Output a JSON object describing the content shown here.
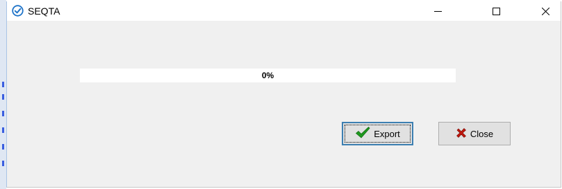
{
  "window": {
    "title": "SEQTA",
    "app_icon": "check-circle-icon",
    "controls": {
      "minimize_icon": "minimize-icon",
      "maximize_icon": "maximize-icon",
      "close_icon": "close-icon"
    }
  },
  "progress": {
    "value": 0,
    "label": "0%",
    "fill_color": "#06b025"
  },
  "buttons": {
    "export": {
      "label": "Export",
      "icon": "checkmark-icon",
      "icon_color": "#1f9a1f"
    },
    "close": {
      "label": "Close",
      "icon": "red-x-icon",
      "icon_color": "#c0180e"
    }
  },
  "colors": {
    "accent": "#1e73c8",
    "focus_border": "#3c7fb1"
  }
}
